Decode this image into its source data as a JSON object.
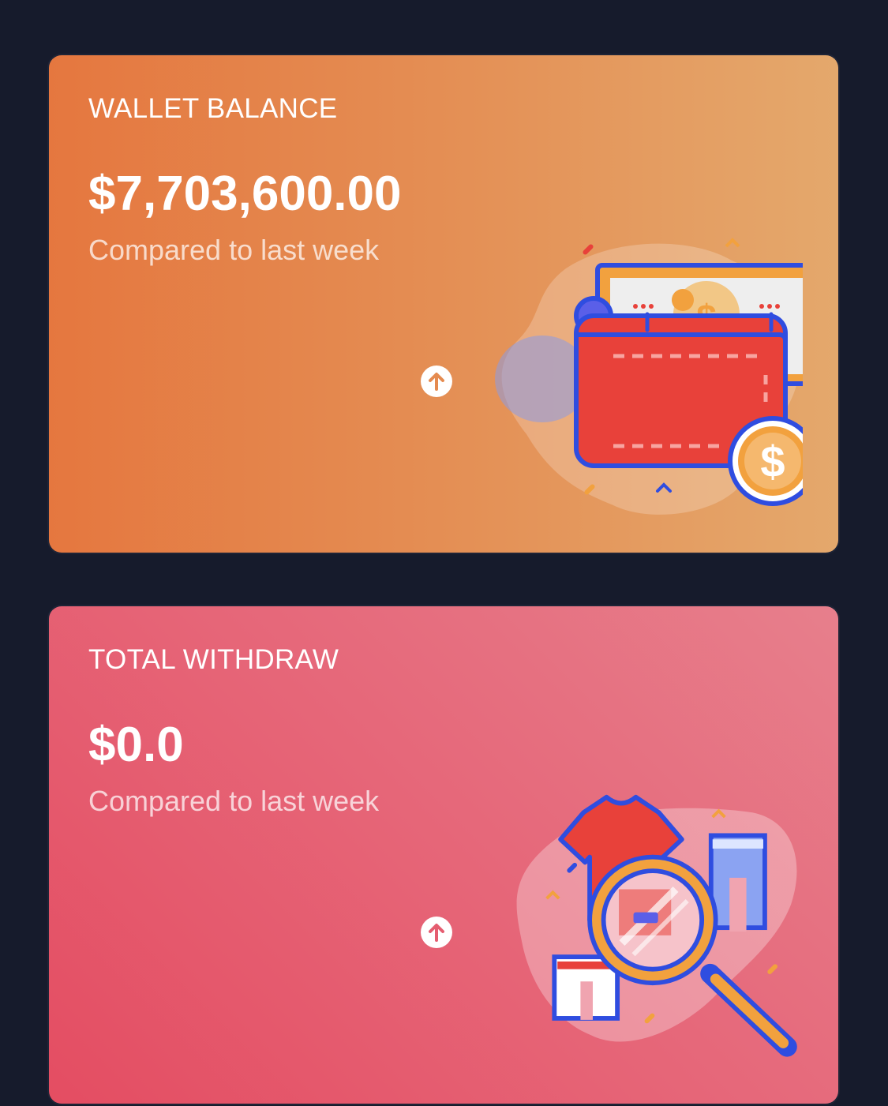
{
  "cards": [
    {
      "title": "WALLET BALANCE",
      "amount": "$7,703,600.00",
      "comparison": "Compared to last week",
      "trend_icon": "arrow-up-circle-icon",
      "illustration": "wallet-illustration"
    },
    {
      "title": "TOTAL WITHDRAW",
      "amount": "$0.0",
      "comparison": "Compared to last week",
      "trend_icon": "arrow-up-circle-icon",
      "illustration": "search-clothes-illustration"
    }
  ],
  "colors": {
    "background": "#161b2c",
    "wallet_gradient_start": "#e5773f",
    "wallet_gradient_end": "#e4a86c",
    "withdraw_gradient_start": "#e44d62",
    "withdraw_gradient_end": "#e77f8c",
    "illustration_blue": "#2f4de0",
    "illustration_red": "#e8413a",
    "illustration_orange": "#f2a13e"
  }
}
